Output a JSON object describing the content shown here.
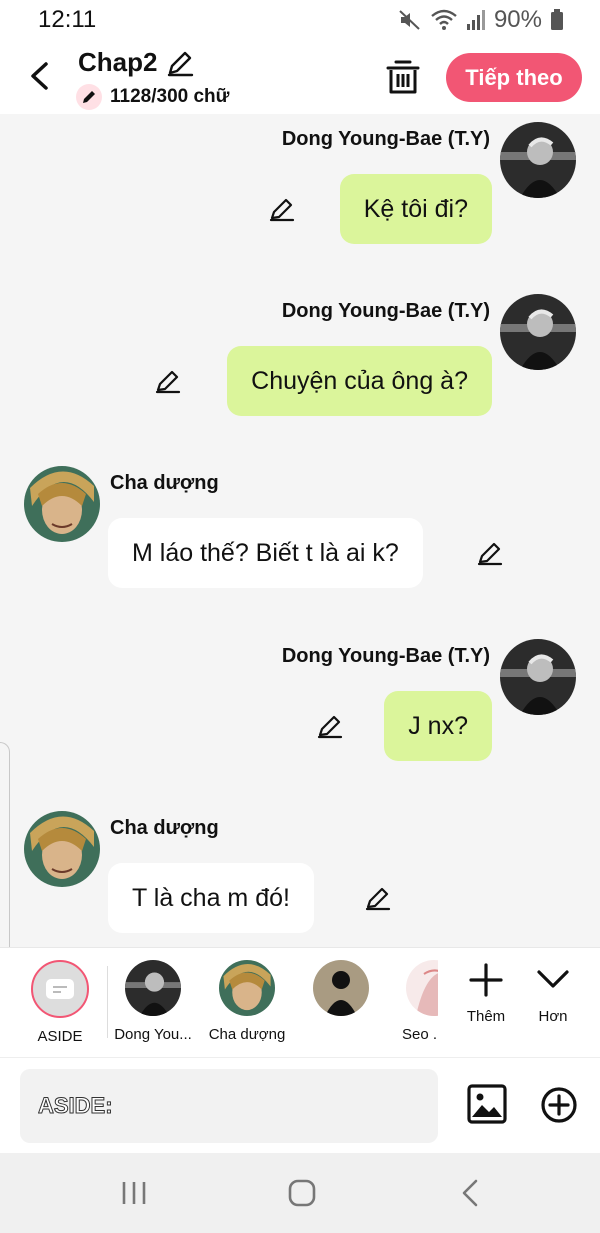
{
  "status": {
    "time": "12:11",
    "battery": "90%"
  },
  "header": {
    "title": "Chap2",
    "word_count": "1128/300 chữ",
    "next_label": "Tiếp theo"
  },
  "messages": [
    {
      "sender": "Dong Young-Bae (T.Y)",
      "text": "Kệ tôi đi?",
      "side": "right"
    },
    {
      "sender": "Dong Young-Bae (T.Y)",
      "text": "Chuyện của ông à?",
      "side": "right"
    },
    {
      "sender": "Cha dượng",
      "text": "M láo thế? Biết t là ai k?",
      "side": "left"
    },
    {
      "sender": "Dong Young-Bae (T.Y)",
      "text": "J nx?",
      "side": "right"
    },
    {
      "sender": "Cha dượng",
      "text": "T là cha m đó!",
      "side": "left"
    }
  ],
  "characters": [
    {
      "label": "ASIDE"
    },
    {
      "label": "Dong You..."
    },
    {
      "label": "Cha dượng"
    },
    {
      "label": ""
    },
    {
      "label": "Seo ."
    }
  ],
  "actions": {
    "add_label": "Thêm",
    "more_label": "Hơn"
  },
  "input": {
    "placeholder": "ASIDE:"
  },
  "colors": {
    "accent": "#f25674",
    "my_bubble": "#dbf59b",
    "other_bubble": "#ffffff",
    "background": "#f5f5f5"
  }
}
